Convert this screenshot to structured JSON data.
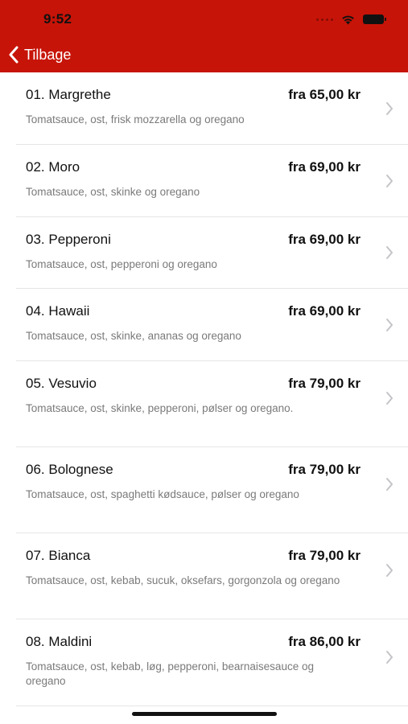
{
  "status_bar": {
    "time": "9:52"
  },
  "nav": {
    "back_label": "Tilbage"
  },
  "items": [
    {
      "name": "01. Margrethe",
      "price": "fra 65,00 kr",
      "description": "Tomatsauce, ost, frisk mozzarella og oregano"
    },
    {
      "name": "02. Moro",
      "price": "fra 69,00 kr",
      "description": "Tomatsauce, ost, skinke og oregano"
    },
    {
      "name": "03. Pepperoni",
      "price": "fra 69,00 kr",
      "description": "Tomatsauce, ost, pepperoni og oregano"
    },
    {
      "name": "04. Hawaii",
      "price": "fra 69,00 kr",
      "description": "Tomatsauce, ost, skinke, ananas og oregano"
    },
    {
      "name": "05. Vesuvio",
      "price": "fra 79,00 kr",
      "description": "Tomatsauce, ost, skinke, pepperoni, pølser og oregano."
    },
    {
      "name": "06. Bolognese",
      "price": "fra 79,00 kr",
      "description": "Tomatsauce, ost, spaghetti kødsauce, pølser og oregano"
    },
    {
      "name": "07. Bianca",
      "price": "fra 79,00 kr",
      "description": "Tomatsauce, ost, kebab, sucuk, oksefars, gorgonzola og oregano"
    },
    {
      "name": "08. Maldini",
      "price": "fra 86,00 kr",
      "description": "Tomatsauce, ost, kebab, løg, pepperoni, bearnaisesauce og oregano"
    }
  ],
  "colors": {
    "brand_red": "#c71408",
    "chevron": "#c4c4c8",
    "description_gray": "#7a7a7a"
  }
}
